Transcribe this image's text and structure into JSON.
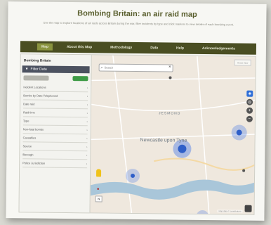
{
  "page": {
    "title": "Bombing Britain: an air raid map",
    "intro": "Use the map to explore locations of air raids across Britain during the war, filter incidents by type and click markers to view details of each bombing event."
  },
  "nav": {
    "items": [
      {
        "label": "Map",
        "active": true
      },
      {
        "label": "About this Map",
        "active": false
      },
      {
        "label": "Methodology",
        "active": false
      },
      {
        "label": "Data",
        "active": false
      },
      {
        "label": "Help",
        "active": false
      },
      {
        "label": "Acknowledgements",
        "active": false
      }
    ]
  },
  "sidebar": {
    "title": "Bombing Britain",
    "filter_label": "Filter Data",
    "filters": [
      {
        "label": "Incident Locations"
      },
      {
        "label": "Bombs by Date Telephoned"
      },
      {
        "label": "Date raid"
      },
      {
        "label": "Raid time"
      },
      {
        "label": "Type"
      },
      {
        "label": "Non-fatal bombs"
      },
      {
        "label": "Casualties"
      },
      {
        "label": "Source"
      },
      {
        "label": "Borough"
      },
      {
        "label": "Police Jurisdiction"
      }
    ]
  },
  "map": {
    "search_placeholder": "Search",
    "district_label": "JESMOND",
    "place_label": "Newcastle upon Tyne",
    "reset_label": "Reset View",
    "side_button": "N",
    "attribution": "Map data © contributors",
    "colors": {
      "land": "#efe8de",
      "river": "#a9c6d9",
      "cluster": "#4f7fe6",
      "road": "#ffffff"
    }
  }
}
